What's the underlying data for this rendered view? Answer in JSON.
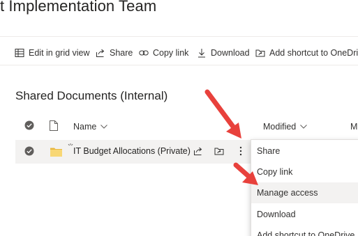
{
  "site": {
    "title": "t Implementation Team"
  },
  "commandbar": {
    "edit_grid": "Edit in grid view",
    "share": "Share",
    "copy_link": "Copy link",
    "download": "Download",
    "add_shortcut": "Add shortcut to OneDrive"
  },
  "library": {
    "title": "Shared Documents (Internal)"
  },
  "columns": {
    "name": "Name",
    "modified": "Modified",
    "modified_by": "M"
  },
  "row": {
    "name": "IT Budget Allocations (Private)"
  },
  "context_menu": {
    "items": [
      "Share",
      "Copy link",
      "Manage access",
      "Download",
      "Add shortcut to OneDrive"
    ],
    "highlighted": "Manage access"
  },
  "colors": {
    "annotation_arrow": "#e8413c",
    "folder": "#f8d775",
    "check_bg": "#605e5c",
    "hover_bg": "#f3f2f1"
  }
}
